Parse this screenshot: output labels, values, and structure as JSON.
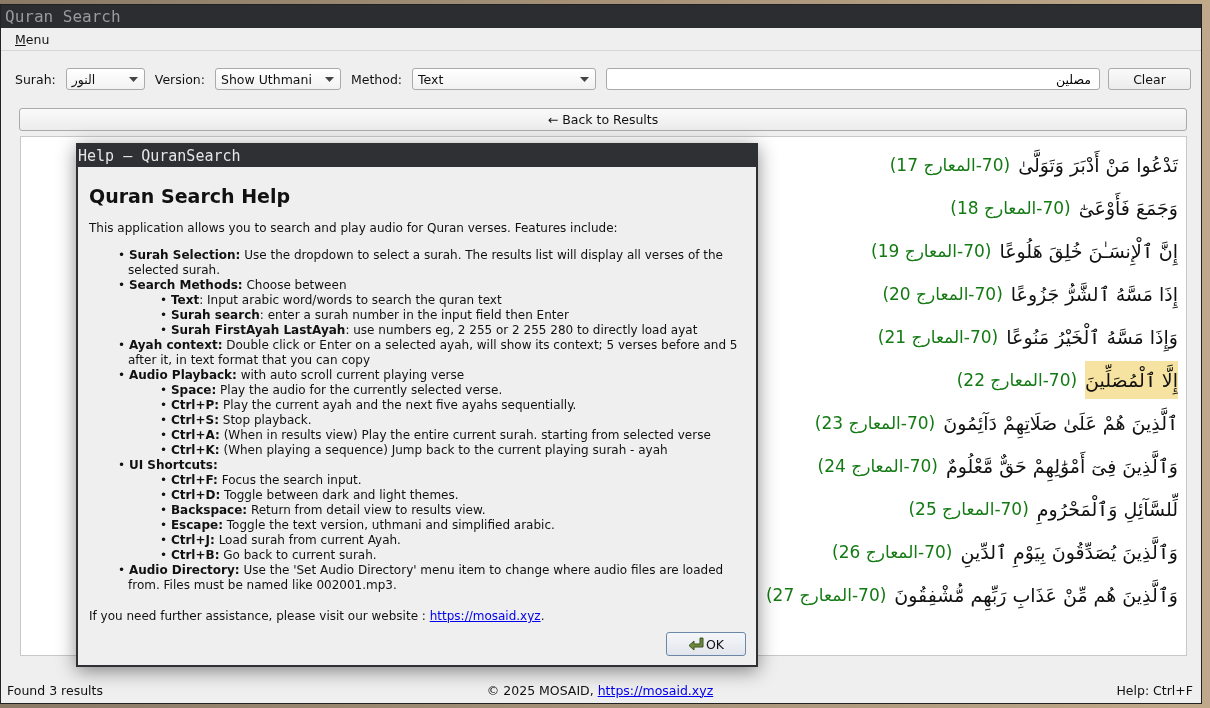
{
  "window": {
    "title": "Quran Search"
  },
  "menu": [
    "Menu"
  ],
  "toolbar": {
    "surah_label": "Surah:",
    "surah": "النور",
    "version_label": "Version:",
    "version": "Show Uthmani",
    "method_label": "Method:",
    "method": "Text",
    "search_value": "مصلين",
    "clear_button": "Clear"
  },
  "back_button": "← Back to Results",
  "results": [
    {
      "verse": "تَدْعُوا مَنْ أَدْبَرَ وَتَوَلَّىٰ",
      "reference": "(70-المعارج 17)",
      "selected": false
    },
    {
      "verse": "وَجَمَعَ فَأَوْعَىٰٓ",
      "reference": "(70-المعارج 18)",
      "selected": false
    },
    {
      "verse": "إِنَّ ٱلْإِنسَـٰنَ خُلِقَ هَلُوعًا",
      "reference": "(70-المعارج 19)",
      "selected": false
    },
    {
      "verse": "إِذَا مَسَّهُ ٱلشَّرُّ جَزُوعًا",
      "reference": "(70-المعارج 20)",
      "selected": false
    },
    {
      "verse": "وَإِذَا مَسَّهُ ٱلْخَيْرُ مَنُوعًا",
      "reference": "(70-المعارج 21)",
      "selected": false
    },
    {
      "verse": "إِلَّا ٱلْمُصَلِّينَ",
      "reference": "(70-المعارج 22)",
      "selected": true
    },
    {
      "verse": "ٱلَّذِينَ هُمْ عَلَىٰ صَلَاتِهِمْ دَآئِمُونَ",
      "reference": "(70-المعارج 23)",
      "selected": false
    },
    {
      "verse": "وَٱلَّذِينَ فِىٓ أَمْوَٰلِهِمْ حَقٌّ مَّعْلُومٌ",
      "reference": "(70-المعارج 24)",
      "selected": false
    },
    {
      "verse": "لِّلسَّآئِلِ وَٱلْمَحْرُومِ",
      "reference": "(70-المعارج 25)",
      "selected": false
    },
    {
      "verse": "وَٱلَّذِينَ يُصَدِّقُونَ بِيَوْمِ ٱلدِّينِ",
      "reference": "(70-المعارج 26)",
      "selected": false
    },
    {
      "verse": "وَٱلَّذِينَ هُم مِّنْ عَذَابِ رَبِّهِم مُّشْفِقُونَ",
      "reference": "(70-المعارج 27)",
      "selected": false
    }
  ],
  "help_dialog": {
    "title": "Help — QuranSearch",
    "heading": "Quran Search Help",
    "intro": "This application allows you to search and play audio for Quran verses. Features include:",
    "items": [
      {
        "text": "• **Surah Selection:** Use the dropdown to select a surah. The results list will display all verses of the selected surah."
      },
      {
        "text": "• **Search Methods:** Choose between",
        "children": [
          {
            "text": "• **Text**: Input arabic word/words to search the quran text"
          },
          {
            "text": "• **Surah search**: enter a surah number in the input field then Enter"
          },
          {
            "text": "• **Surah FirstAyah LastAyah**: use numbers eg, 2 255 or 2 255 280 to directly load ayat"
          }
        ]
      },
      {
        "text": "• **Ayah context:** Double click or Enter on a selected ayah, will show its context; 5 verses before and 5 after it, in text format that you can copy"
      },
      {
        "text": "• **Audio Playback:** with auto scroll current playing verse",
        "children": [
          {
            "text": "• **Space:** Play the audio for the currently selected verse."
          },
          {
            "text": "• **Ctrl+P:** Play the current ayah and the next five ayahs sequentially."
          },
          {
            "text": "• **Ctrl+S:** Stop playback."
          },
          {
            "text": "• **Ctrl+A:** (When in results view) Play the entire current surah. starting from selected verse"
          },
          {
            "text": "• **Ctrl+K:** (When playing a sequence) Jump back to the current playing surah - ayah"
          }
        ]
      },
      {
        "text": "• **UI Shortcuts:**",
        "children": [
          {
            "text": "• **Ctrl+F:** Focus the search input."
          },
          {
            "text": "• **Ctrl+D:** Toggle between dark and light themes."
          },
          {
            "text": "• **Backspace:** Return from detail view to results view."
          },
          {
            "text": "• **Escape:** Toggle the text version, uthmani and simplified arabic."
          },
          {
            "text": "• **Ctrl+J:** Load surah from current Ayah."
          },
          {
            "text": "• **Ctrl+B:** Go back to current surah."
          }
        ]
      },
      {
        "text": "• **Audio Directory:** Use the 'Set Audio Directory' menu item to change where audio files are loaded from. Files must be named like 002001.mp3."
      }
    ],
    "footer": "If you need further assistance, please visit our website : ",
    "footer_link": "https://mosaid.xyz",
    "footer_end": ".",
    "ok_button": "OK"
  },
  "status_bar": {
    "left": "Found 3 results",
    "center": "© 2025 MOSAID, ",
    "center_link": "https://mosaid.xyz",
    "right": "Help: Ctrl+F"
  }
}
